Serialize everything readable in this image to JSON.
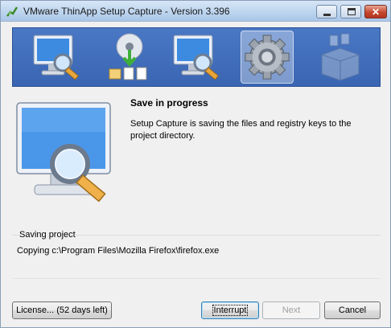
{
  "window": {
    "title": "VMware ThinApp Setup Capture - Version 3.396"
  },
  "banner": {
    "steps": [
      {
        "icon": "monitor-magnifier-icon",
        "state": "done"
      },
      {
        "icon": "install-disc-icon",
        "state": "done"
      },
      {
        "icon": "monitor-magnifier-icon",
        "state": "done"
      },
      {
        "icon": "gear-icon",
        "state": "active"
      },
      {
        "icon": "package-box-icon",
        "state": "pending"
      }
    ]
  },
  "content": {
    "heading": "Save in progress",
    "description": "Setup Capture is saving the files and registry keys to the project directory."
  },
  "progress_group": {
    "label": "Saving project",
    "status_text": "Copying c:\\Program Files\\Mozilla Firefox\\firefox.exe"
  },
  "buttons": {
    "license": "License... (52 days left)",
    "interrupt": "Interrupt",
    "next": "Next",
    "cancel": "Cancel"
  },
  "colors": {
    "banner_blue": "#3a65b3",
    "active_step_highlight": "#ffffff"
  }
}
